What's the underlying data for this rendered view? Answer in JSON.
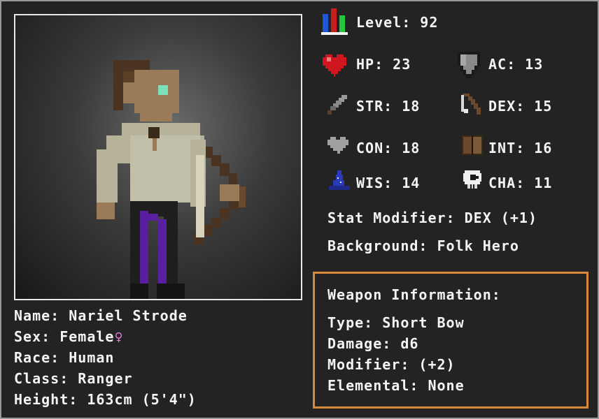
{
  "level": {
    "label": "Level:",
    "value": "92"
  },
  "stats": {
    "hp": {
      "label": "HP:",
      "value": "23"
    },
    "ac": {
      "label": "AC:",
      "value": "13"
    },
    "str": {
      "label": "STR:",
      "value": "18"
    },
    "dex": {
      "label": "DEX:",
      "value": "15"
    },
    "con": {
      "label": "CON:",
      "value": "18"
    },
    "int": {
      "label": "INT:",
      "value": "16"
    },
    "wis": {
      "label": "WIS:",
      "value": "14"
    },
    "cha": {
      "label": "CHA:",
      "value": "11"
    }
  },
  "stat_modifier": "Stat Modifier: DEX (+1)",
  "background": "Background: Folk Hero",
  "character": {
    "name": "Name: Nariel Strode",
    "sex": "Sex: Female",
    "sex_symbol": "♀",
    "race": "Race: Human",
    "class": "Class: Ranger",
    "height": "Height: 163cm (5'4\")"
  },
  "weapon": {
    "title": "Weapon Information:",
    "type": "Type: Short Bow",
    "damage": "Damage: d6",
    "modifier": "Modifier: (+2)",
    "elemental": "Elemental: None"
  },
  "colors": {
    "accent_border": "#d8883a",
    "sex_symbol": "#e07adf"
  },
  "icons": [
    "level-bars-icon",
    "heart-icon",
    "shield-icon",
    "sword-icon",
    "bow-icon",
    "gray-heart-icon",
    "book-icon",
    "wizard-hat-icon",
    "skull-icon"
  ]
}
